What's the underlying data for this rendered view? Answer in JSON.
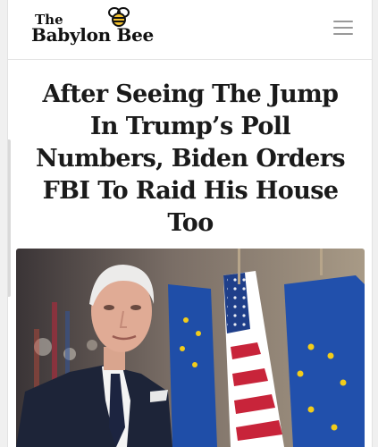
{
  "site": {
    "logo_top": "The",
    "logo_name": "Babylon Bee",
    "logo_icon": "bee-icon",
    "menu_icon": "hamburger-menu-icon"
  },
  "article": {
    "headline": "After Seeing The Jump In Trump’s Poll Numbers, Biden Orders FBI To Raid His House Too",
    "image_description": "photo-of-man-in-suit-in-front-of-flags"
  },
  "colors": {
    "background": "#ffffff",
    "text": "#1a1a1a",
    "eu_blue": "#1f4ea8",
    "eu_star": "#f2cc1a",
    "us_red": "#c8243a",
    "menu_gray": "#999999"
  }
}
